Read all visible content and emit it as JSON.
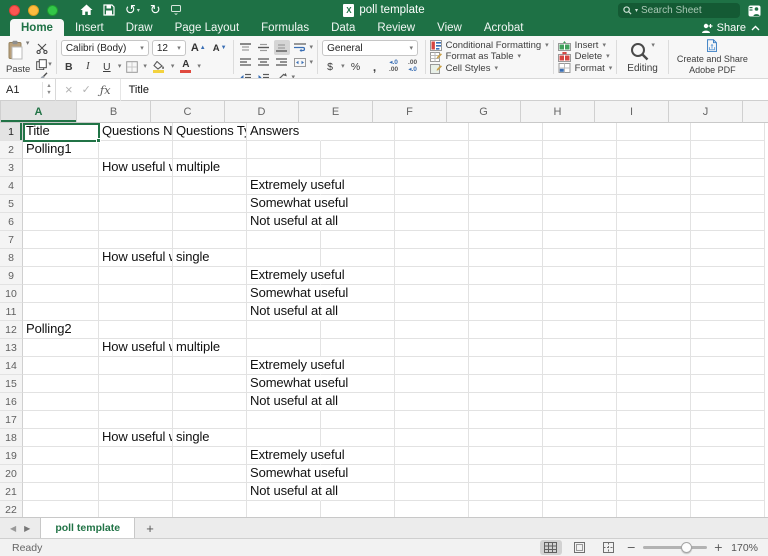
{
  "titlebar": {
    "title": "poll template",
    "search_placeholder": "Search Sheet"
  },
  "menu_tabs": [
    {
      "label": "Home",
      "active": true
    },
    {
      "label": "Insert"
    },
    {
      "label": "Draw"
    },
    {
      "label": "Page Layout"
    },
    {
      "label": "Formulas"
    },
    {
      "label": "Data"
    },
    {
      "label": "Review"
    },
    {
      "label": "View"
    },
    {
      "label": "Acrobat"
    }
  ],
  "share": {
    "label": "Share"
  },
  "ribbon": {
    "paste": "Paste",
    "font_name": "Calibri (Body)",
    "font_size": "12",
    "grow_font": "A",
    "shrink_font": "A",
    "bold": "B",
    "italic": "I",
    "underline": "U",
    "font_color_letter": "A",
    "number_format": "General",
    "currency": "$",
    "percent": "%",
    "comma": ",",
    "dec1_top": "◂.0",
    "dec1_bot": ".00",
    "dec2_top": ".00",
    "dec2_bot": "◂.0",
    "styles": [
      {
        "label": "Conditional Formatting"
      },
      {
        "label": "Format as Table"
      },
      {
        "label": "Cell Styles"
      }
    ],
    "cells": [
      {
        "label": "Insert"
      },
      {
        "label": "Delete"
      },
      {
        "label": "Format"
      }
    ],
    "editing": "Editing",
    "adobe_line1": "Create and Share",
    "adobe_line2": "Adobe PDF"
  },
  "formula_bar": {
    "name_box": "A1",
    "cancel": "×",
    "enter": "✓",
    "fx": "ƒx",
    "formula": "Title"
  },
  "grid": {
    "columns": [
      "A",
      "B",
      "C",
      "D",
      "E",
      "F",
      "G",
      "H",
      "I",
      "J"
    ],
    "selected_cell": "A1",
    "selected_column": "A",
    "selected_row": 1,
    "rows": [
      {
        "n": 1,
        "cells": {
          "A": "Title",
          "B": "Questions Na",
          "C": "Questions Ty",
          "D": "Answers"
        }
      },
      {
        "n": 2,
        "cells": {
          "A": "Polling1"
        }
      },
      {
        "n": 3,
        "cells": {
          "B": "How useful w",
          "C": "multiple"
        }
      },
      {
        "n": 4,
        "cells": {
          "D": "Extremely useful"
        }
      },
      {
        "n": 5,
        "cells": {
          "D": "Somewhat useful"
        }
      },
      {
        "n": 6,
        "cells": {
          "D": "Not useful at all"
        }
      },
      {
        "n": 7,
        "cells": {}
      },
      {
        "n": 8,
        "cells": {
          "B": "How useful w",
          "C": "single"
        }
      },
      {
        "n": 9,
        "cells": {
          "D": "Extremely useful"
        }
      },
      {
        "n": 10,
        "cells": {
          "D": "Somewhat useful"
        }
      },
      {
        "n": 11,
        "cells": {
          "D": "Not useful at all"
        }
      },
      {
        "n": 12,
        "cells": {
          "A": "Polling2"
        }
      },
      {
        "n": 13,
        "cells": {
          "B": "How useful w",
          "C": "multiple"
        }
      },
      {
        "n": 14,
        "cells": {
          "D": "Extremely useful"
        }
      },
      {
        "n": 15,
        "cells": {
          "D": "Somewhat useful"
        }
      },
      {
        "n": 16,
        "cells": {
          "D": "Not useful at all"
        }
      },
      {
        "n": 17,
        "cells": {}
      },
      {
        "n": 18,
        "cells": {
          "B": "How useful w",
          "C": "single"
        }
      },
      {
        "n": 19,
        "cells": {
          "D": "Extremely useful"
        }
      },
      {
        "n": 20,
        "cells": {
          "D": "Somewhat useful"
        }
      },
      {
        "n": 21,
        "cells": {
          "D": "Not useful at all"
        }
      },
      {
        "n": 22,
        "cells": {}
      }
    ]
  },
  "sheet_tabs": {
    "active_tab": "poll template",
    "add_label": "+"
  },
  "status": {
    "ready": "Ready",
    "zoom": "170%"
  },
  "colors": {
    "excel_green": "#1e7145",
    "accent": "#217346"
  }
}
